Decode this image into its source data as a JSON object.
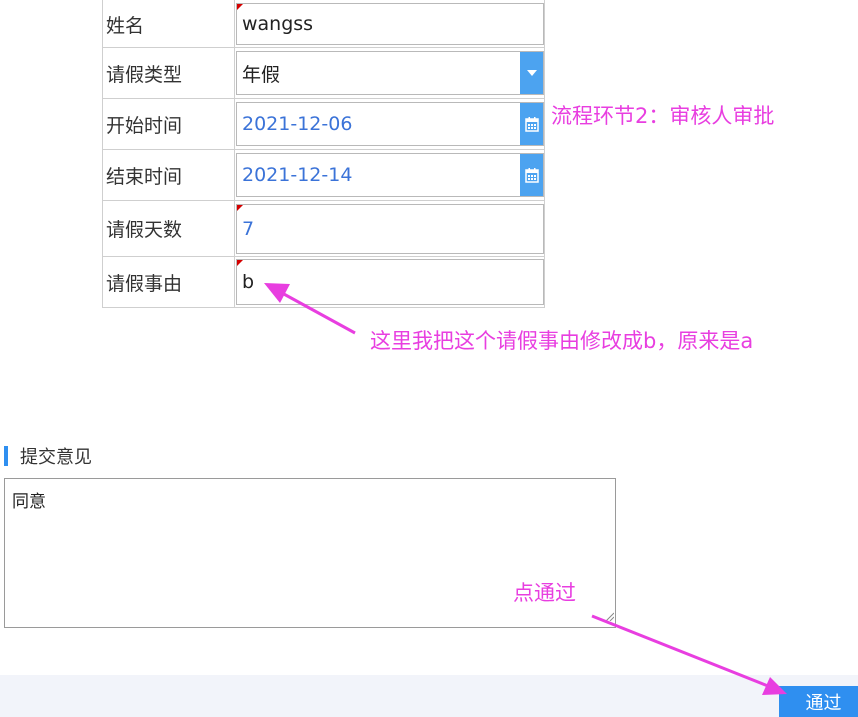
{
  "form": {
    "rows": [
      {
        "label": "姓名",
        "value": "wangss"
      },
      {
        "label": "请假类型",
        "value": "年假"
      },
      {
        "label": "开始时间",
        "value": "2021-12-06"
      },
      {
        "label": "结束时间",
        "value": "2021-12-14"
      },
      {
        "label": "请假天数",
        "value": "7"
      },
      {
        "label": "请假事由",
        "value": "b"
      }
    ]
  },
  "annotations": {
    "step_note": "流程环节2：审核人审批",
    "reason_note": "这里我把这个请假事由修改成b，原来是a",
    "click_note": "点通过"
  },
  "comment": {
    "section_title": "提交意见",
    "text": "同意"
  },
  "actions": {
    "approve_label": "通过"
  },
  "colors": {
    "accent": "#2f8ff0",
    "annotation": "#e83ee0",
    "date_text": "#3b73d8",
    "required_marker": "#d40000"
  },
  "icons": {
    "type_select": "caret-down-icon",
    "date_picker": "calendar-icon"
  }
}
